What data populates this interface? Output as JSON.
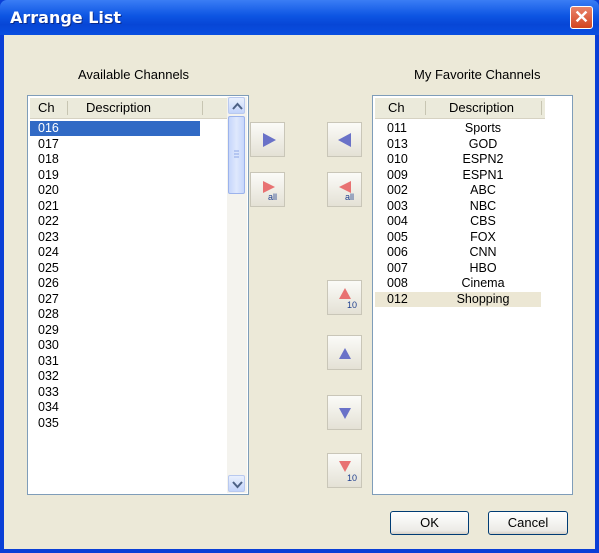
{
  "window": {
    "title": "Arrange List",
    "close_glyph": "✕"
  },
  "available": {
    "caption": "Available Channels",
    "col_ch": "Ch",
    "col_desc": "Description",
    "rows": [
      "016",
      "017",
      "018",
      "019",
      "020",
      "021",
      "022",
      "023",
      "024",
      "025",
      "026",
      "027",
      "028",
      "029",
      "030",
      "031",
      "032",
      "033",
      "034",
      "035"
    ],
    "selected_index": 0
  },
  "favorites": {
    "caption": "My Favorite Channels",
    "col_ch": "Ch",
    "col_desc": "Description",
    "rows": [
      {
        "ch": "011",
        "desc": "Sports"
      },
      {
        "ch": "013",
        "desc": "GOD"
      },
      {
        "ch": "010",
        "desc": "ESPN2"
      },
      {
        "ch": "009",
        "desc": "ESPN1"
      },
      {
        "ch": "002",
        "desc": "ABC"
      },
      {
        "ch": "003",
        "desc": "NBC"
      },
      {
        "ch": "004",
        "desc": "CBS"
      },
      {
        "ch": "005",
        "desc": "FOX"
      },
      {
        "ch": "006",
        "desc": "CNN"
      },
      {
        "ch": "007",
        "desc": "HBO"
      },
      {
        "ch": "008",
        "desc": "Cinema"
      },
      {
        "ch": "012",
        "desc": "Shopping"
      }
    ],
    "highlighted_index": 11
  },
  "tools": {
    "add_all_sub": "all",
    "remove_all_sub": "all",
    "move_up_10_sub": "10",
    "move_down_10_sub": "10"
  },
  "buttons": {
    "ok": "OK",
    "cancel": "Cancel"
  },
  "colors": {
    "blue_arrow": "#6a72c8",
    "red_arrow": "#e87272",
    "selection": "#316ac5"
  }
}
